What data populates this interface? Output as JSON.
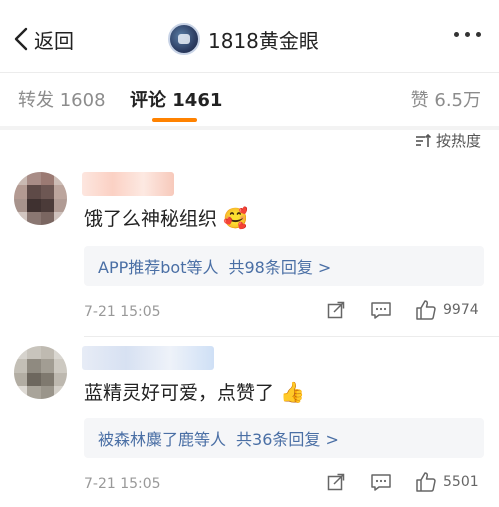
{
  "header": {
    "back_label": "返回",
    "title": "1818黄金眼"
  },
  "tabs": [
    {
      "label": "转发 1608",
      "active": false
    },
    {
      "label": "评论 1461",
      "active": true
    },
    {
      "label": "赞 6.5万",
      "active": false
    }
  ],
  "accent_color": "#ff8200",
  "link_color": "#4a6fa5",
  "sort_label": "按热度",
  "comments": [
    {
      "text": "饿了么神秘组织",
      "emoji": "🥰",
      "reply_names": "APP推荐bot等人",
      "reply_count": "共98条回复 >",
      "time": "7-21 15:05",
      "likes": "9974"
    },
    {
      "text": "蓝精灵好可爱，点赞了",
      "emoji": "👍",
      "reply_names": "被森林麋了鹿等人",
      "reply_count": "共36条回复 >",
      "time": "7-21 15:05",
      "likes": "5501"
    }
  ]
}
